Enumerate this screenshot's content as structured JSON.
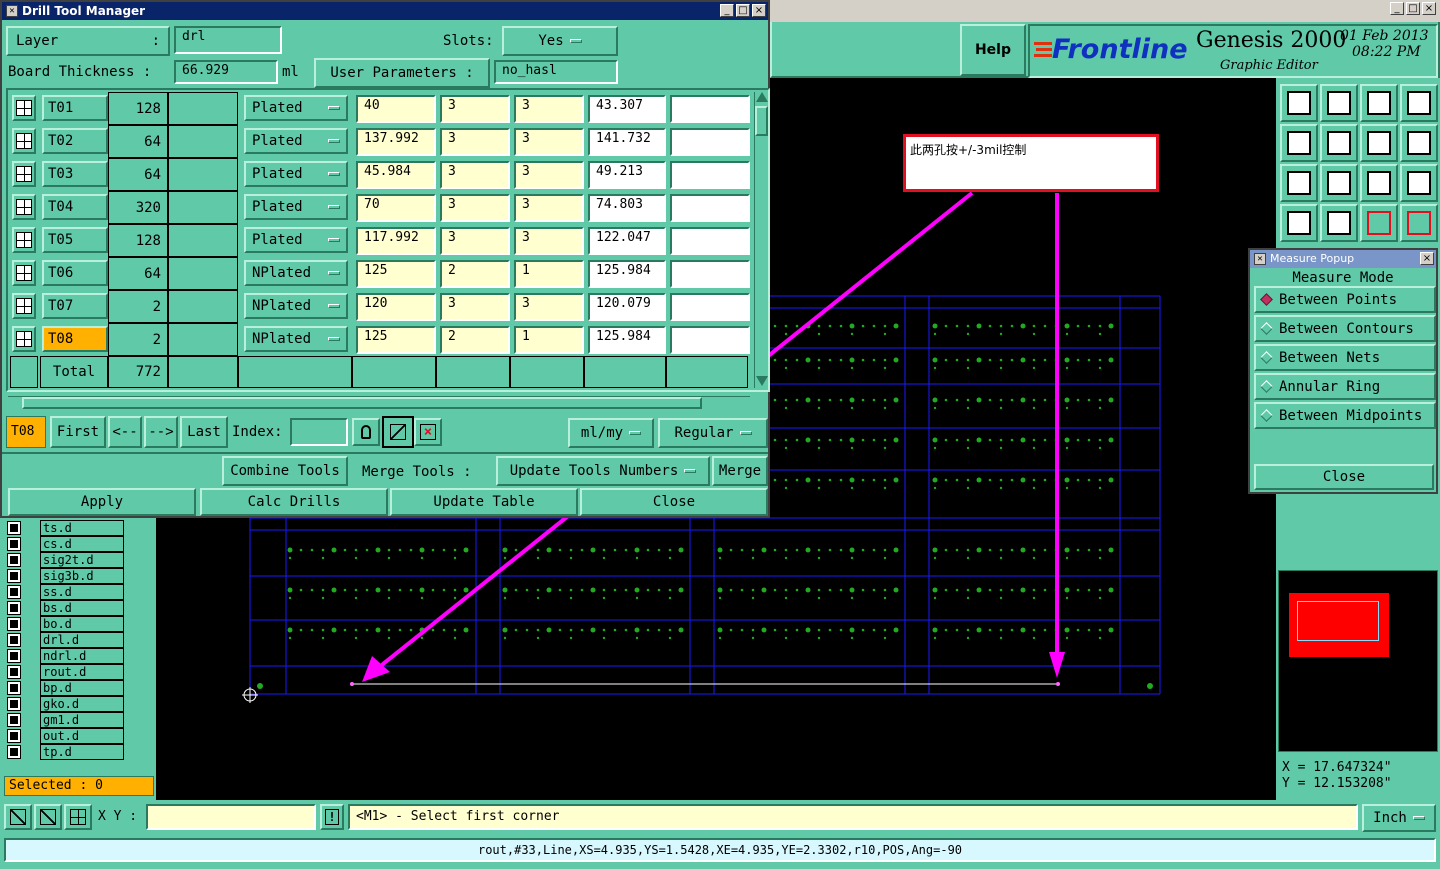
{
  "drill_window": {
    "title": "Drill Tool Manager",
    "layer_label": "Layer",
    "layer_colon": ":",
    "layer_value": "drl",
    "slots_label": "Slots:",
    "slots_value": "Yes",
    "board_thickness_label": "Board Thickness :",
    "board_thickness_value": "66.929",
    "board_thickness_unit": "ml",
    "user_params_label": "User Parameters :",
    "user_params_value": "no_hasl",
    "tools": [
      {
        "name": "T01",
        "count": "128",
        "type": "Plated",
        "size": "40",
        "tol_plus": "3",
        "tol_minus": "3",
        "finish": "43.307"
      },
      {
        "name": "T02",
        "count": "64",
        "type": "Plated",
        "size": "137.992",
        "tol_plus": "3",
        "tol_minus": "3",
        "finish": "141.732"
      },
      {
        "name": "T03",
        "count": "64",
        "type": "Plated",
        "size": "45.984",
        "tol_plus": "3",
        "tol_minus": "3",
        "finish": "49.213"
      },
      {
        "name": "T04",
        "count": "320",
        "type": "Plated",
        "size": "70",
        "tol_plus": "3",
        "tol_minus": "3",
        "finish": "74.803"
      },
      {
        "name": "T05",
        "count": "128",
        "type": "Plated",
        "size": "117.992",
        "tol_plus": "3",
        "tol_minus": "3",
        "finish": "122.047"
      },
      {
        "name": "T06",
        "count": "64",
        "type": "NPlated",
        "size": "125",
        "tol_plus": "2",
        "tol_minus": "1",
        "finish": "125.984"
      },
      {
        "name": "T07",
        "count": "2",
        "type": "NPlated",
        "size": "120",
        "tol_plus": "3",
        "tol_minus": "3",
        "finish": "120.079"
      },
      {
        "name": "T08",
        "count": "2",
        "type": "NPlated",
        "size": "125",
        "tol_plus": "2",
        "tol_minus": "1",
        "finish": "125.984"
      }
    ],
    "total_label": "Total",
    "total_value": "772",
    "current_tool": "T08",
    "nav": {
      "first": "First",
      "prev": "<--",
      "next": "-->",
      "last": "Last",
      "index_label": "Index:"
    },
    "units_value": "ml/my",
    "mode_value": "Regular",
    "combine_tools": "Combine Tools",
    "merge_tools": "Merge Tools :",
    "update_tool_numbers": "Update Tools Numbers",
    "merge": "Merge",
    "apply": "Apply",
    "calc_drills": "Calc Drills",
    "update_table": "Update Table",
    "close": "Close"
  },
  "main": {
    "help": "Help",
    "brand": "Frontline",
    "product": "Genesis 2000",
    "subtitle": "Graphic Editor",
    "date": "01 Feb 2013",
    "time": "08:22 PM"
  },
  "annotation": {
    "text": "此两孔按+/-3mil控制"
  },
  "layers": [
    "ts.d",
    "cs.d",
    "sig2t.d",
    "sig3b.d",
    "ss.d",
    "bs.d",
    "bo.d",
    "drl.d",
    "ndrl.d",
    "rout.d",
    "bp.d",
    "gko.d",
    "gm1.d",
    "out.d",
    "tp.d"
  ],
  "selected_label": "Selected : 0",
  "measure": {
    "title": "Measure Popup",
    "mode_label": "Measure Mode",
    "options": [
      "Between Points",
      "Between Contours",
      "Between Nets",
      "Annular Ring",
      "Between Midpoints"
    ],
    "selected_index": 0,
    "close": "Close"
  },
  "coords": {
    "x": "X  =  17.647324\"",
    "y": "Y  =  12.153208\""
  },
  "bottom": {
    "xy_label": "X Y :",
    "prompt": "<M1> - Select first corner",
    "units": "Inch",
    "status": "rout,#33,Line,XS=4.935,YS=1.5428,XE=4.935,YE=2.3302,r10,POS,Ang=-90"
  },
  "colors": {
    "panel": "#5fc9a8",
    "field": "#ffffd0",
    "board": "#1a1aff",
    "pads": "#22aa22",
    "arrow": "#ff00ff",
    "tool_selected": "#ffb000"
  }
}
